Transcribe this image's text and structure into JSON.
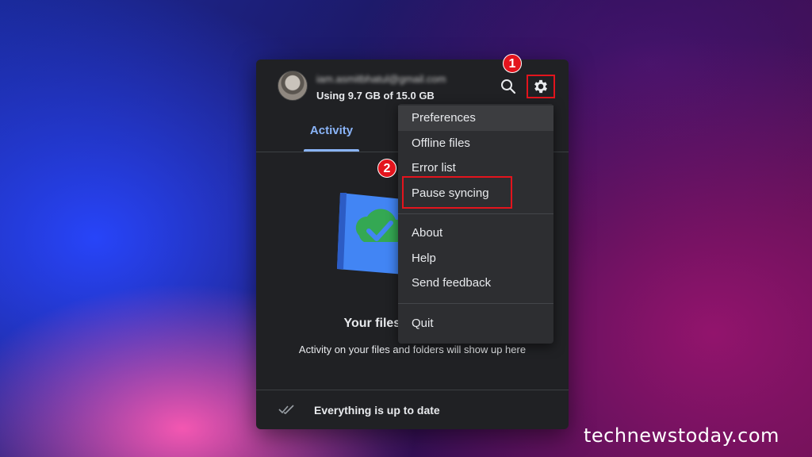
{
  "account": {
    "email": "iam.asmitbhatul@gmail.com",
    "storage_text": "Using 9.7 GB of 15.0 GB"
  },
  "header": {
    "search_icon": "search-icon",
    "settings_icon": "gear-icon"
  },
  "tabs": [
    {
      "label": "Activity",
      "active": true
    }
  ],
  "empty_state": {
    "title": "Your files a",
    "description": "Activity on your files and folders will show up here"
  },
  "footer": {
    "status": "Everything is up to date",
    "status_icon": "double-check-icon"
  },
  "settings_menu": {
    "group1": [
      "Preferences",
      "Offline files",
      "Error list",
      "Pause syncing"
    ],
    "group2": [
      "About",
      "Help",
      "Send feedback"
    ],
    "group3": [
      "Quit"
    ],
    "hovered": "Preferences"
  },
  "annotations": {
    "step1": "1",
    "step2": "2",
    "highlight_color": "#e3141d"
  },
  "watermark": "technewstoday.com",
  "colors": {
    "accent": "#8ab4f8",
    "panel_bg": "#202124",
    "menu_bg": "#2d2e31"
  }
}
